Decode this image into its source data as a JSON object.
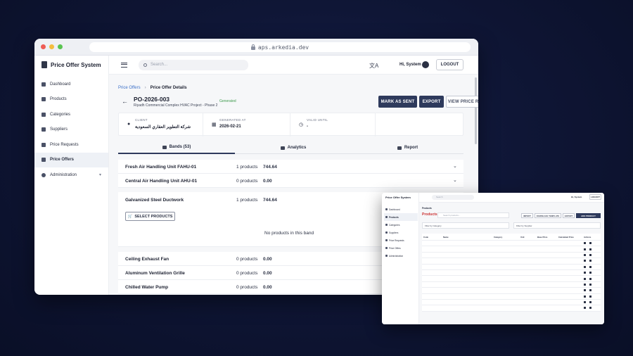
{
  "browser": {
    "url": "aps.arkedia.dev"
  },
  "app": {
    "name": "Price Offer System",
    "sidebar": {
      "items": [
        {
          "label": "Dashboard"
        },
        {
          "label": "Products"
        },
        {
          "label": "Categories"
        },
        {
          "label": "Suppliers"
        },
        {
          "label": "Price Requests"
        },
        {
          "label": "Price Offers"
        },
        {
          "label": "Administration"
        }
      ],
      "active": "Price Offers"
    },
    "topbar": {
      "search_placeholder": "Search...",
      "greeting": "Hi, System",
      "logout": "LOGOUT",
      "translate_icon": "文A"
    },
    "breadcrumb": {
      "parent": "Price Offers",
      "separator": "›",
      "current": "Price Offer Details"
    },
    "offer": {
      "number": "PO-2026-003",
      "project": "Riyadh Commercial Complex HVAC Project - Phase 2",
      "status": "Generated"
    },
    "actions": {
      "mark_sent": "MARK AS SENT",
      "export": "EXPORT",
      "view_request": "VIEW PRICE REQUEST"
    },
    "info": {
      "client_label": "CLIENT",
      "client_value": "شركة التطوير العقاري السعودية",
      "generated_label": "GENERATED AT",
      "generated_value": "2026-02-21",
      "valid_label": "VALID UNTIL",
      "valid_value": "-"
    },
    "tabs": [
      {
        "label": "Bands (53)"
      },
      {
        "label": "Analytics"
      },
      {
        "label": "Report"
      }
    ],
    "bands": [
      {
        "name": "Fresh Air Handling Unit FAHU-01",
        "count": "1 products",
        "total": "744.64"
      },
      {
        "name": "Central Air Handling Unit AHU-01",
        "count": "0 products",
        "total": "0.00"
      },
      {
        "name": "Galvanized Steel Ductwork",
        "count": "1 products",
        "total": "744.64"
      },
      {
        "name": "Ceiling Exhaust Fan",
        "count": "0 products",
        "total": "0.00"
      },
      {
        "name": "Aluminum Ventilation Grille",
        "count": "0 products",
        "total": "0.00"
      },
      {
        "name": "Chilled Water Pump",
        "count": "0 products",
        "total": "0.00"
      }
    ],
    "expanded_band": {
      "select_button": "SELECT PRODUCTS",
      "empty_text": "No products in this band"
    }
  },
  "products_window": {
    "brand": "Price Offer System",
    "nav": [
      "Dashboard",
      "Products",
      "Categories",
      "Suppliers",
      "Price Requests",
      "Price Offers",
      "Administration"
    ],
    "active": "Products",
    "search_placeholder": "Search",
    "greeting": "Hi, System",
    "logout": "LOGOUT",
    "crumb": "Products",
    "title": "Products",
    "table_search": "Search products...",
    "buttons": [
      "IMPORT",
      "DOWNLOAD TEMPLATE",
      "EXPORT",
      "ADD PRODUCT"
    ],
    "filter_category": "Filter by Category",
    "filter_supplier": "Filter by Supplier",
    "columns": [
      "Code",
      "Name",
      "Category",
      "Unit",
      "Base Price",
      "Calculated Price",
      "Actions"
    ],
    "rows": [
      [
        "",
        "",
        "",
        "",
        "",
        "",
        ""
      ],
      [
        "",
        "",
        "",
        "",
        "",
        "",
        ""
      ],
      [
        "",
        "",
        "",
        "",
        "",
        "",
        ""
      ],
      [
        "",
        "",
        "",
        "",
        "",
        "",
        ""
      ],
      [
        "",
        "",
        "",
        "",
        "",
        "",
        ""
      ],
      [
        "",
        "",
        "",
        "",
        "",
        "",
        ""
      ],
      [
        "",
        "",
        "",
        "",
        "",
        "",
        ""
      ],
      [
        "",
        "",
        "",
        "",
        "",
        "",
        ""
      ],
      [
        "",
        "",
        "",
        "",
        "",
        "",
        ""
      ],
      [
        "",
        "",
        "",
        "",
        "",
        "",
        ""
      ],
      [
        "",
        "",
        "",
        "",
        "",
        "",
        ""
      ],
      [
        "",
        "",
        "",
        "",
        "",
        "",
        ""
      ]
    ]
  }
}
